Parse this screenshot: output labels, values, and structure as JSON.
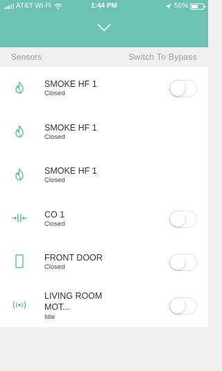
{
  "status_bar": {
    "carrier": "AT&T Wi-Fi",
    "time": "1:44 PM",
    "battery": "55%",
    "battery_level": 0.55
  },
  "header": {
    "left": "Sensors",
    "right": "Switch To Bypass"
  },
  "sensors": [
    {
      "icon": "flame-icon",
      "name": "SMOKE HF 1",
      "status": "Closed",
      "has_toggle": true,
      "toggle_on": false
    },
    {
      "icon": "flame-icon",
      "name": "SMOKE HF 1",
      "status": "Closed",
      "has_toggle": false
    },
    {
      "icon": "flame-icon",
      "name": "SMOKE HF 1",
      "status": "Closed",
      "has_toggle": false
    },
    {
      "icon": "co-sensor-icon",
      "name": "CO 1",
      "status": "Closed",
      "has_toggle": true,
      "toggle_on": false
    },
    {
      "icon": "door-icon",
      "name": "FRONT DOOR",
      "status": "Closed",
      "has_toggle": true,
      "toggle_on": false
    },
    {
      "icon": "motion-sensor-icon",
      "name": "LIVING ROOM MOT...",
      "status": "Idle",
      "has_toggle": true,
      "toggle_on": false
    }
  ],
  "colors": {
    "accent": "#6cc3b3",
    "icon": "#4fb6a7"
  }
}
